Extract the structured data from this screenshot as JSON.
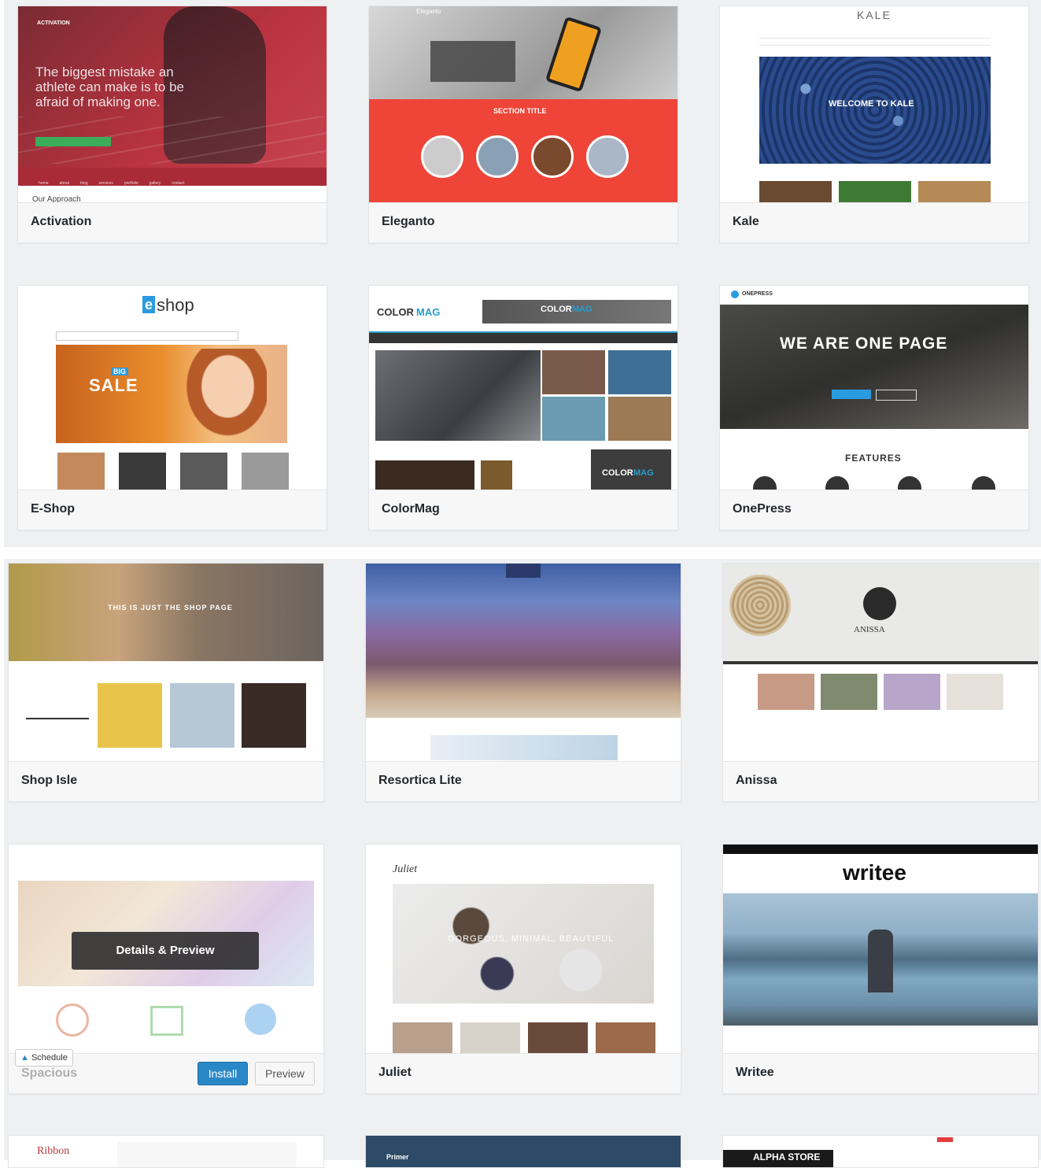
{
  "themes_row1": [
    {
      "name": "Activation",
      "hero_label": "ACTIVATION",
      "hero_text": "The biggest mistake an athlete can make is to be afraid of making one.",
      "section_heading": "Our Approach"
    },
    {
      "name": "Eleganto",
      "hero_label": "Eleganto",
      "section_title": "SECTION TITLE"
    },
    {
      "name": "Kale",
      "logo": "KALE",
      "hero_text": "WELCOME TO KALE"
    }
  ],
  "themes_row2": [
    {
      "name": "E-Shop",
      "logo": "eshop",
      "logo_mark": "e",
      "logo_rest": "shop",
      "banner_big": "BIG",
      "banner_sale": "SALE"
    },
    {
      "name": "ColorMag",
      "logo_a": "COLOR",
      "logo_b": "MAG",
      "banner_a": "COLOR",
      "banner_b": "MAG"
    },
    {
      "name": "OnePress",
      "logo": "ONEPRESS",
      "hero_text": "WE ARE ONE PAGE",
      "features": "FEATURES"
    }
  ],
  "themes_row3": [
    {
      "name": "Shop Isle",
      "hero_text": "THIS IS JUST THE SHOP PAGE"
    },
    {
      "name": "Resortica Lite"
    },
    {
      "name": "Anissa",
      "logo": "ANISSA"
    }
  ],
  "themes_row4": [
    {
      "name": "Spacious",
      "overlay_label": "Details & Preview",
      "install_label": "Install",
      "preview_label": "Preview",
      "schedule_label": "Schedule"
    },
    {
      "name": "Juliet",
      "logo": "Juliet",
      "hero_text": "GORGEOUS, MINIMAL, BEAUTIFUL"
    },
    {
      "name": "Writee",
      "logo": "writee"
    }
  ],
  "themes_row5": [
    {
      "name": "Ribbon"
    },
    {
      "name": "Primer"
    },
    {
      "name": "Alpha Store",
      "logo": "ALPHA STORE"
    }
  ],
  "colors": {
    "panel": "#eef0f1",
    "install": "#2b88c7",
    "eleganto_red": "#ee4538",
    "activation_red": "#b8333f",
    "colormag_blue": "#289dcc"
  }
}
